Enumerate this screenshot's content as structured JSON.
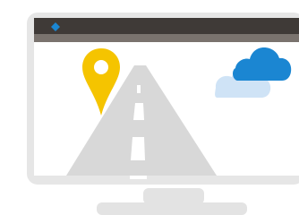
{
  "illustration": {
    "subject": "monitor-with-road-map-pin-and-clouds",
    "icons": [
      "monitor-icon",
      "window-titlebar-icon",
      "map-pin-icon",
      "road-icon",
      "cloud-icon",
      "cloud-icon"
    ]
  },
  "colors": {
    "frame": "#e6e6e6",
    "screen": "#ffffff",
    "titlebar_dark": "#3f3a37",
    "titlebar_band": "#7a736e",
    "titlebar_dot": "#1b86d2",
    "road": "#d8d8d8",
    "road_markings": "#ffffff",
    "pin": "#f5c400",
    "cloud_front": "#1b86d2",
    "cloud_back": "#cfe3f6",
    "stand": "#e3e3e3"
  }
}
